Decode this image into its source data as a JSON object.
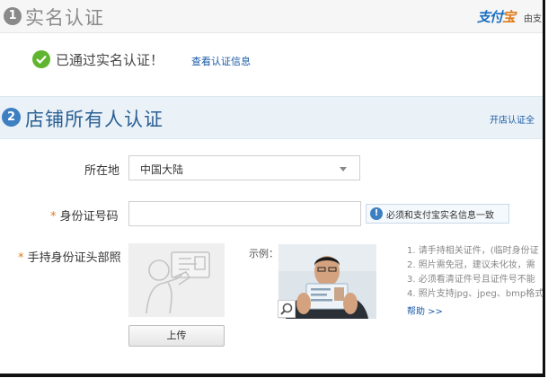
{
  "section1": {
    "number": "1",
    "title": "实名认证",
    "brand_part1": "支付",
    "brand_part2": "宝",
    "partner_text": "由支",
    "verified_text": "已通过实名认证！",
    "view_link": "查看认证信息"
  },
  "section2": {
    "number": "2",
    "title": "店铺所有人认证",
    "flow_link": "开店认证全",
    "location_label": "所在地",
    "location_value": "中国大陆",
    "id_label": "身份证号码",
    "id_value": "",
    "id_hint": "必须和支付宝实名信息一致",
    "photo_label": "手持身份证头部照",
    "upload_button": "上传",
    "example_label": "示例：",
    "notes": [
      "1. 请手持相关证件，(临时身份证",
      "2. 照片需免冠，建议未化妆，需",
      "3. 必须看清证件号且证件号不能",
      "4. 照片支持jpg、jpeg、bmp格式"
    ],
    "help_link": "帮助 >>"
  },
  "colors": {
    "accent_blue": "#3d7fc0",
    "link_blue": "#1b5aa6",
    "success_green": "#5fb52f",
    "required_orange": "#e07b1a"
  },
  "icons": [
    "number-badge-icon",
    "check-circle-icon",
    "info-icon",
    "dropdown-caret-icon",
    "id-card-placeholder-icon",
    "zoom-icon"
  ]
}
